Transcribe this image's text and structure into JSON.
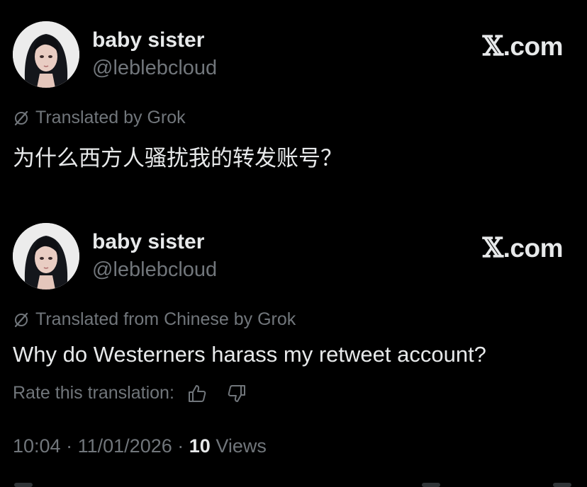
{
  "posts": [
    {
      "display_name": "baby sister",
      "handle": "@leblebcloud",
      "brand": {
        "x": "𝕏",
        "suffix": ".com"
      },
      "translated_label": "Translated by Grok",
      "text": "为什么西方人骚扰我的转发账号？",
      "avatar_icon": "avatar-girl-icon"
    },
    {
      "display_name": "baby sister",
      "handle": "@leblebcloud",
      "brand": {
        "x": "𝕏",
        "suffix": ".com"
      },
      "translated_label": "Translated from Chinese by Grok",
      "text": "Why do Westerners harass my retweet account?",
      "rate_label": "Rate this translation:",
      "avatar_icon": "avatar-girl-icon"
    }
  ],
  "meta": {
    "time": "10:04",
    "separator": "·",
    "date": "11/01/2026",
    "views_count": "10",
    "views_label": "Views"
  },
  "colors": {
    "background": "#000000",
    "primary_text": "#e7e9ea",
    "secondary_text": "#71767b"
  },
  "icons": {
    "translate": "grok-translate-icon",
    "thumbs_up": "thumbs-up-icon",
    "thumbs_down": "thumbs-down-icon"
  }
}
